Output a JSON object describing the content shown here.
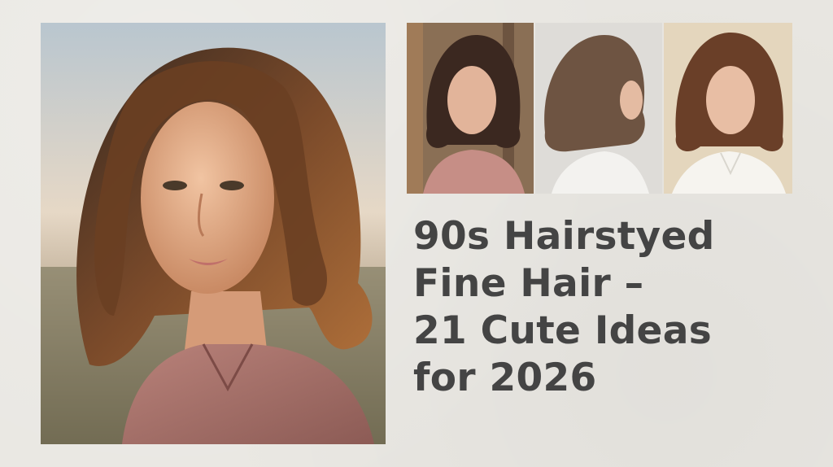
{
  "images": {
    "main": "portrait-woman-wavy-bob-sunset",
    "thumbs": [
      "woman-wavy-lob-window-front",
      "woman-wavy-bob-side-profile",
      "woman-wavy-bob-white-shirt"
    ]
  },
  "headline": {
    "line1": "90s Hairstyed",
    "line2": "Fine Hair –",
    "line3": "21 Cute Ideas",
    "line4": "for 2026"
  },
  "colors": {
    "background": "#e9e7e2",
    "headline": "#444444"
  }
}
